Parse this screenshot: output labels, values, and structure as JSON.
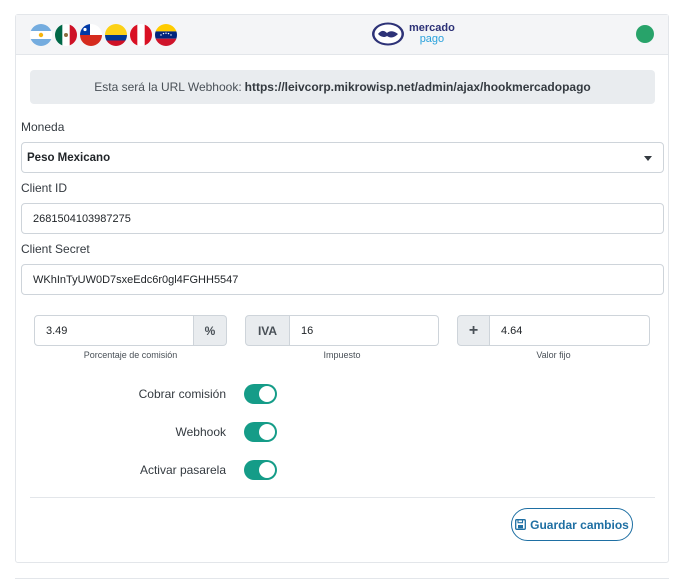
{
  "header": {
    "flags": [
      "argentina-flag",
      "mexico-flag",
      "chile-flag",
      "colombia-flag",
      "peru-flag",
      "venezuela-flag"
    ],
    "brand": {
      "line1": "mercado",
      "line2": "pago"
    },
    "status_color": "#28a36a"
  },
  "webhook": {
    "prefix": "Esta será la URL Webhook:",
    "url": "https://leivcorp.mikrowisp.net/admin/ajax/hookmercadopago"
  },
  "form": {
    "currency": {
      "label": "Moneda",
      "value": "Peso Mexicano"
    },
    "client_id": {
      "label": "Client ID",
      "value": "2681504103987275"
    },
    "client_secret": {
      "label": "Client Secret",
      "value": "WKhInTyUW0D7sxeEdc6r0gl4FGHH5547"
    }
  },
  "fees": {
    "commission": {
      "value": "3.49",
      "addon": "%",
      "caption": "Porcentaje de comisión"
    },
    "tax": {
      "value": "16",
      "addon": "IVA",
      "caption": "Impuesto"
    },
    "fixed": {
      "value": "4.64",
      "addon": "+",
      "caption": "Valor fijo"
    }
  },
  "toggles": [
    {
      "label": "Cobrar comisión",
      "on": true
    },
    {
      "label": "Webhook",
      "on": true
    },
    {
      "label": "Activar pasarela",
      "on": true
    }
  ],
  "actions": {
    "save_label": "Guardar cambios"
  },
  "colors": {
    "accent": "#159c88",
    "primary": "#1e6fa3"
  }
}
